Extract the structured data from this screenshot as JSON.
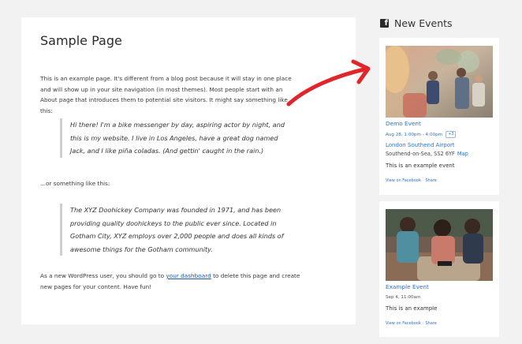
{
  "page": {
    "title": "Sample Page",
    "intro": "This is an example page. It's different from a blog post because it will stay in one place and will show up in your site navigation (in most themes). Most people start with an About page that introduces them to potential site visitors. It might say something like this:",
    "quote1": "Hi there! I'm a bike messenger by day, aspiring actor by night, and this is my website. I live in Los Angeles, have a great dog named Jack, and I like piña coladas. (And gettin' caught in the rain.)",
    "middle": "...or something like this:",
    "quote2": "The XYZ Doohickey Company was founded in 1971, and has been providing quality doohickeys to the public ever since. Located in Gotham City, XYZ employs over 2,000 people and does all kinds of awesome things for the Gotham community.",
    "outro_before": "As a new WordPress user, you should go to ",
    "outro_link": "your dashboard",
    "outro_after": " to delete this page and create new pages for your content. Have fun!"
  },
  "sidebar": {
    "icon": "facebook-icon",
    "title": "New Events",
    "events": [
      {
        "title": "Demo Event",
        "date": "Aug 28, 1:00pm - 4:00pm",
        "more": "+3",
        "venue": "London Southend Airport",
        "address": "Southend-on-Sea, SS2 6YF",
        "map_label": "Map",
        "description": "This is an example event",
        "view_label": "View on Facebook",
        "dot": "·",
        "share_label": "Share"
      },
      {
        "title": "Example Event",
        "date": "Sep 4, 11:00am",
        "description": "This is an example",
        "view_label": "View on Facebook",
        "dot": "·",
        "share_label": "Share"
      }
    ]
  },
  "colors": {
    "arrow": "#e0262a",
    "link": "#2a73c9"
  }
}
